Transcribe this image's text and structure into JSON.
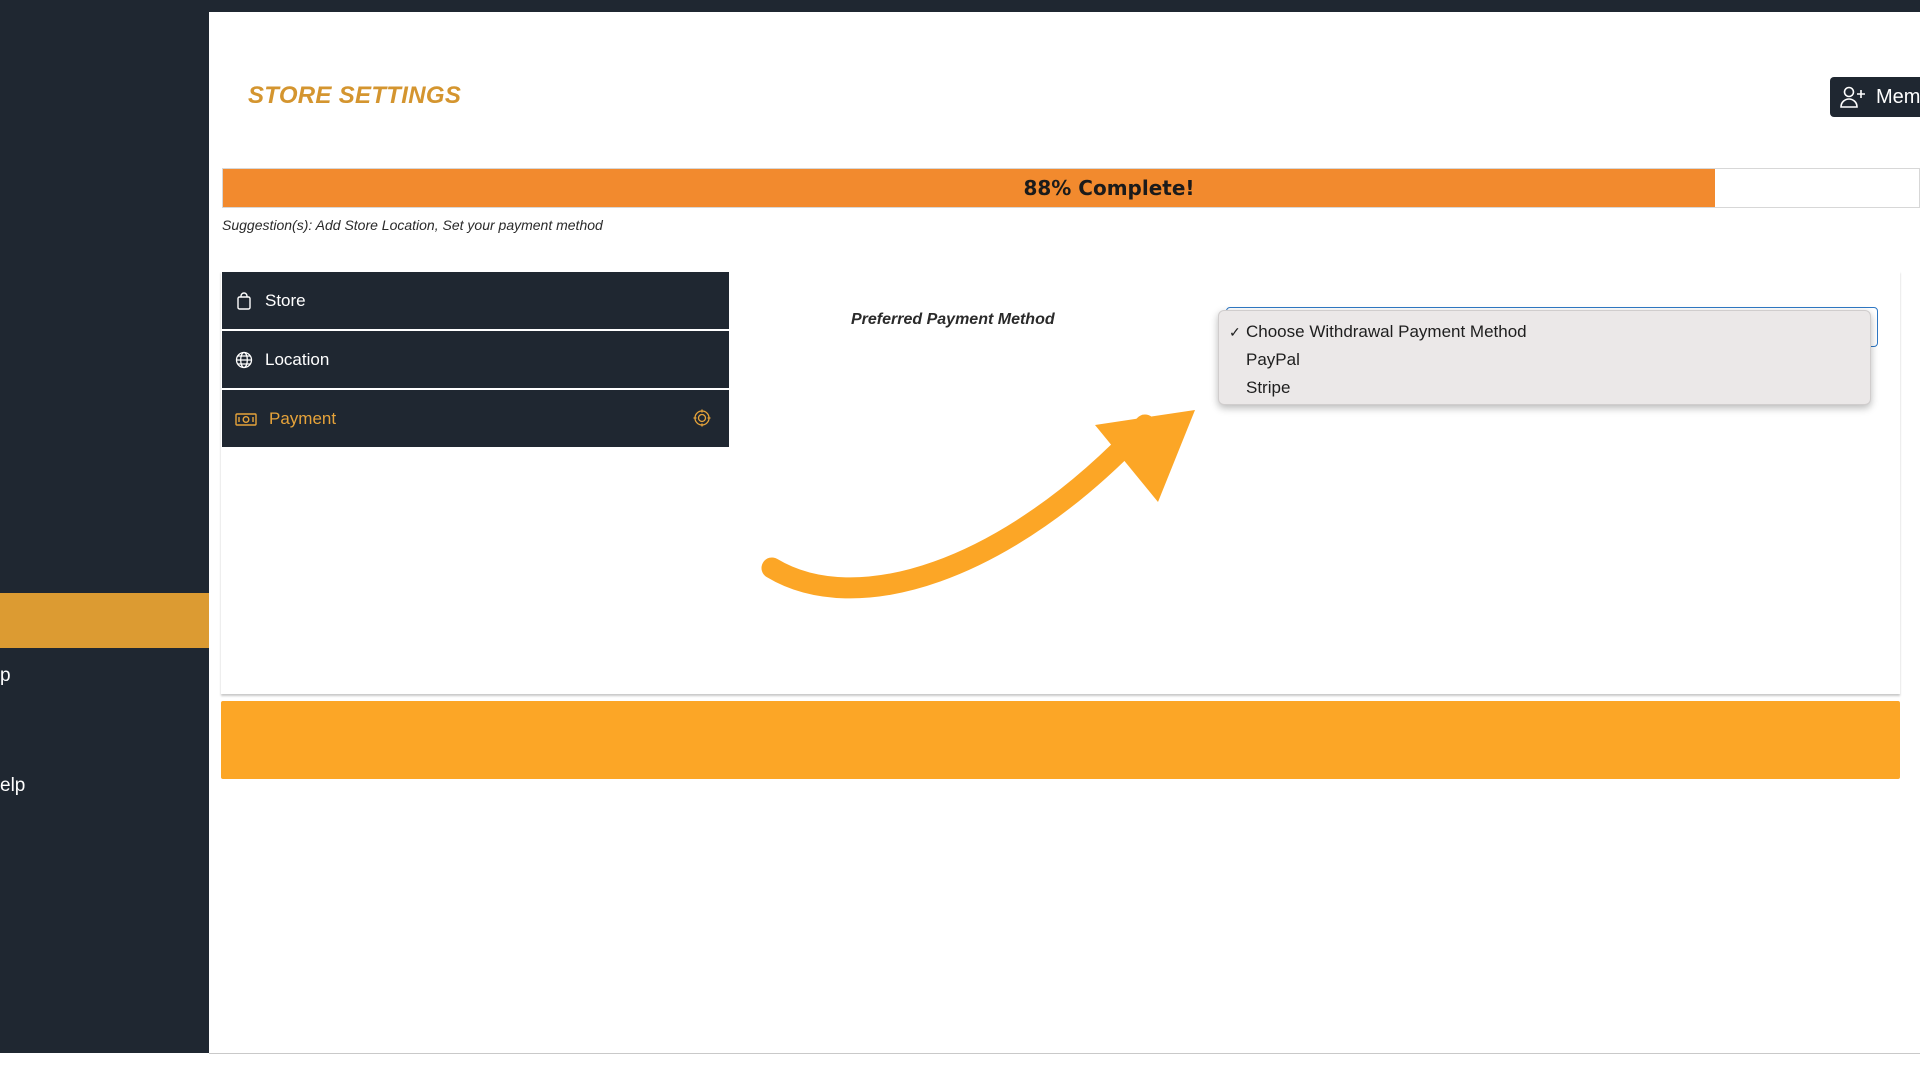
{
  "header": {
    "title": "STORE SETTINGS",
    "member_button_label": "Mem"
  },
  "sidebar": {
    "labels": [
      {
        "text": "p"
      },
      {
        "text": "elp"
      }
    ]
  },
  "progress": {
    "percent": 88,
    "label": "88% Complete!"
  },
  "suggestion": "Suggestion(s): Add Store Location, Set your payment method",
  "menu": {
    "items": [
      {
        "label": "Store",
        "icon": "shopping-bag-icon"
      },
      {
        "label": "Location",
        "icon": "globe-icon"
      },
      {
        "label": "Payment",
        "icon": "money-icon",
        "active": true,
        "status_icon": "target-icon"
      }
    ]
  },
  "payment": {
    "field_label": "Preferred Payment Method",
    "options": [
      {
        "label": "Choose Withdrawal Payment Method",
        "selected": true
      },
      {
        "label": "PayPal",
        "selected": false
      },
      {
        "label": "Stripe",
        "selected": false
      }
    ]
  },
  "colors": {
    "sidebar": "#1f2731",
    "accent": "#d4952f",
    "progress_fill": "#f28a2e",
    "annotation_arrow": "#fca626"
  }
}
